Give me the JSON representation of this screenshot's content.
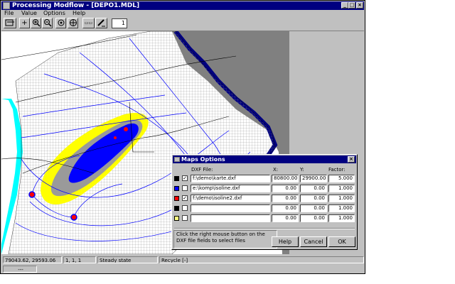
{
  "window": {
    "title": "Processing Modflow - [DEPO1.MDL]",
    "controls": [
      "_",
      "□",
      "×"
    ]
  },
  "menu": {
    "items": [
      "File",
      "Value",
      "Options",
      "Help"
    ]
  },
  "toolbar": {
    "layer_value": "1",
    "icons": [
      "layer-icon",
      "crosshair-icon",
      "zoom-in-icon",
      "zoom-out-icon",
      "pan-icon",
      "refresh-icon",
      "scale-icon",
      "pencil-icon"
    ]
  },
  "status": {
    "coords": "79043.62, 29593.06",
    "cell": "1, 1, 1",
    "state": "Steady state",
    "recycle": "Recycle [-]",
    "bottom": "---"
  },
  "dialog": {
    "title": "Maps Options",
    "headers": {
      "file": "DXF File:",
      "x": "X:",
      "y": "Y:",
      "factor": "Factor:"
    },
    "rows": [
      {
        "color": "#000000",
        "checked": "✓",
        "file": "f:\\demo\\karte.dxf",
        "x": "80800.00",
        "y": "29900.00",
        "factor": "5.000"
      },
      {
        "color": "#0000ff",
        "checked": "",
        "file": "e:\\komp\\isoline.dxf",
        "x": "0.00",
        "y": "0.00",
        "factor": "1.000"
      },
      {
        "color": "#ff0000",
        "checked": "✓",
        "file": "f:\\demo\\isoline2.dxf",
        "x": "0.00",
        "y": "0.00",
        "factor": "1.000"
      },
      {
        "color": "#000000",
        "checked": "",
        "file": "",
        "x": "0.00",
        "y": "0.00",
        "factor": "1.000"
      },
      {
        "color": "#ffff80",
        "checked": "",
        "file": "",
        "x": "0.00",
        "y": "0.00",
        "factor": "1.000"
      }
    ],
    "hint": "Click the right mouse button on the DXF file fields to select files",
    "buttons": {
      "help": "Help",
      "cancel": "Cancel",
      "ok": "OK"
    }
  },
  "colors": {
    "titlebar": "#000080",
    "face": "#c0c0c0",
    "boundary": "#000080",
    "grid": "#808080",
    "contour": "#0000ff",
    "plume_outer": "#ffff00",
    "plume_mid": "#808080",
    "plume_core": "#0000ff",
    "well": "#ff0000",
    "cyan_edge": "#00ffff"
  }
}
